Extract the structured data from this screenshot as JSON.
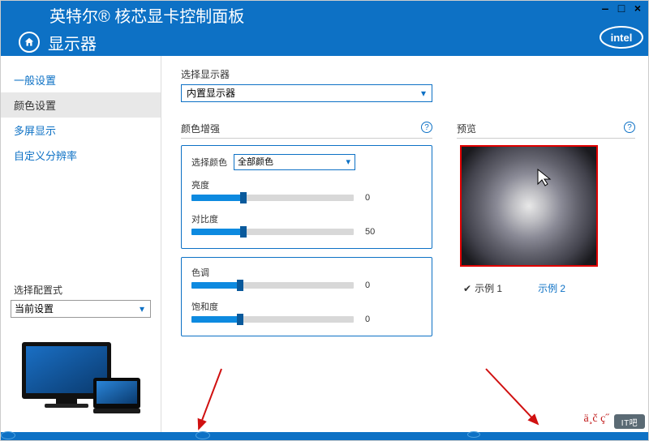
{
  "titlebar": {
    "title": "英特尔® 核芯显卡控制面板"
  },
  "subheader": {
    "title": "显示器",
    "logo_text": "intel"
  },
  "sidebar": {
    "items": [
      {
        "label": "一般设置"
      },
      {
        "label": "颜色设置"
      },
      {
        "label": "多屏显示"
      },
      {
        "label": "自定义分辨率"
      }
    ],
    "config_label": "选择配置式",
    "config_value": "当前设置"
  },
  "main": {
    "display_label": "选择显示器",
    "display_value": "内置显示器",
    "enhance_header": "颜色增强",
    "preview_header": "预览",
    "select_color_label": "选择颜色",
    "select_color_value": "全部颜色",
    "sliders": {
      "brightness": {
        "label": "亮度",
        "value": 0,
        "fill_pct": 32
      },
      "contrast": {
        "label": "对比度",
        "value": 50,
        "fill_pct": 32
      },
      "hue": {
        "label": "色调",
        "value": 0,
        "fill_pct": 30
      },
      "saturation": {
        "label": "饱和度",
        "value": 0,
        "fill_pct": 30
      }
    },
    "examples": {
      "ex1": "示例 1",
      "ex2": "示例 2"
    }
  },
  "overlay": {
    "text": "ä¸č  ç˝",
    "logo": "IT吧"
  }
}
